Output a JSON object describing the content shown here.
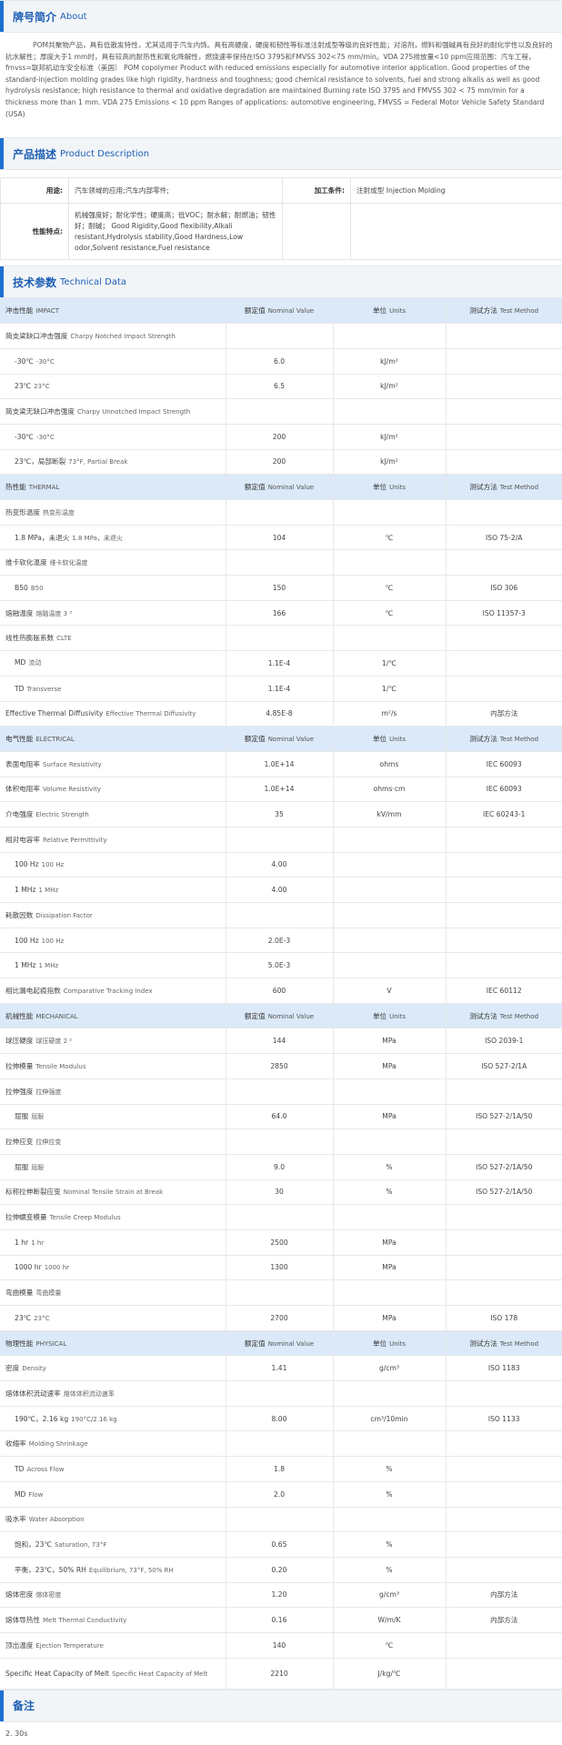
{
  "about": {
    "title_cn": "牌号简介",
    "title_en": "About",
    "text": "POM共聚物产品，具有低散发特性，尤其适用于汽车内饰。具有高硬度，硬度和韧性等标准注射成型等级的良好性能；对溶剂，燃料和强碱具有良好的耐化学性以及良好的抗水解性；厚度大于1 mm时，具有较高的耐热性和氧化降解性，燃烧速率保持在ISO 3795和FMVSS 302<75 mm/min。VDA 275排放量<10 ppm应用范围：汽车工程，fmvss=联邦机动车安全标准（美国） POM copolymer Product with reduced emissions especially for automotive interior application. Good properties of the standard-injection molding grades like high rigidity, hardness and toughness; good chemical resistance to solvents, fuel and strong alkalis as well as good hydrolysis resistance; high resistance to thermal and oxidative degradation are maintained Burning rate ISO 3795 and FMVSS 302 < 75 mm/min for a thickness more than 1 mm. VDA 275 Emissions < 10 ppm Ranges of applications: automotive engineering, FMVSS = Federal Motor Vehicle Safety Standard (USA)"
  },
  "product": {
    "title_cn": "产品描述",
    "title_en": "Product Description",
    "use_label": "用途:",
    "use_value": "汽车领域的应用;汽车内部零件;",
    "process_label": "加工条件:",
    "process_value": "注射成型 Injection Molding",
    "feature_label": "性能特点:",
    "feature_value": "机械强度好；耐化学性；硬度高；低VOC；耐水解；耐燃油；韧性好；耐碱； Good Rigidity,Good flexibility,Alkali resistant,Hydrolysis stability,Good Hardness,Low odor,Solvent resistance,Fuel resistance"
  },
  "tech": {
    "title_cn": "技术参数",
    "title_en": "Technical Data",
    "hdr_nominal_cn": "额定值",
    "hdr_nominal_en": "Nominal Value",
    "hdr_units_cn": "单位",
    "hdr_units_en": "Units",
    "hdr_method_cn": "测试方法",
    "hdr_method_en": "Test Method",
    "rows": [
      {
        "type": "cat",
        "cn": "冲击性能",
        "en": "IMPACT"
      },
      {
        "cn": "简支梁缺口冲击强度",
        "en": "Charpy Notched Impact Strength",
        "v": "",
        "u": "",
        "m": ""
      },
      {
        "sub": true,
        "cn": "-30℃",
        "en": "-30°C",
        "v": "6.0",
        "u": "kJ/m²",
        "m": ""
      },
      {
        "sub": true,
        "cn": "23℃",
        "en": "23°C",
        "v": "6.5",
        "u": "kJ/m²",
        "m": ""
      },
      {
        "cn": "简支梁无缺口冲击强度",
        "en": "Charpy Unnotched Impact Strength",
        "v": "",
        "u": "",
        "m": ""
      },
      {
        "sub": true,
        "cn": "-30℃",
        "en": "-30°C",
        "v": "200",
        "u": "kJ/m²",
        "m": ""
      },
      {
        "sub": true,
        "cn": "23℃，局部断裂",
        "en": "73°F, Partial Break",
        "v": "200",
        "u": "kJ/m²",
        "m": ""
      },
      {
        "type": "cat",
        "cn": "热性能",
        "en": "THERMAL"
      },
      {
        "cn": "热变形温度",
        "en": "热变形温度",
        "v": "",
        "u": "",
        "m": ""
      },
      {
        "sub": true,
        "cn": "1.8 MPa，未退火",
        "en": "1.8 MPa，未退火",
        "v": "104",
        "u": "℃",
        "m": "ISO 75-2/A"
      },
      {
        "cn": "维卡软化温度",
        "en": "维卡软化温度",
        "v": "",
        "u": "",
        "m": ""
      },
      {
        "sub": true,
        "cn": "B50",
        "en": "B50",
        "v": "150",
        "u": "℃",
        "m": "ISO 306"
      },
      {
        "cn": "熔融温度",
        "en": "熔融温度 3 ³",
        "v": "166",
        "u": "℃",
        "m": "ISO 11357-3",
        "link": true
      },
      {
        "cn": "线性热膨胀系数",
        "en": "CLTE",
        "v": "",
        "u": "",
        "m": ""
      },
      {
        "sub": true,
        "cn": "MD",
        "en": "流动",
        "v": "1.1E-4",
        "u": "1/℃",
        "m": ""
      },
      {
        "sub": true,
        "cn": "TD",
        "en": "Transverse",
        "v": "1.1E-4",
        "u": "1/℃",
        "m": ""
      },
      {
        "cn": "Effective Thermal Diffusivity",
        "en": "Effective Thermal Diffusivity",
        "v": "4.85E-8",
        "u": "m²/s",
        "m": "内部方法"
      },
      {
        "type": "cat",
        "cn": "电气性能",
        "en": "ELECTRICAL"
      },
      {
        "cn": "表面电阻率",
        "en": "Surface Resistivity",
        "v": "1.0E+14",
        "u": "ohms",
        "m": "IEC 60093"
      },
      {
        "cn": "体积电阻率",
        "en": "Volume Resistivity",
        "v": "1.0E+14",
        "u": "ohms·cm",
        "m": "IEC 60093"
      },
      {
        "cn": "介电强度",
        "en": "Electric Strength",
        "v": "35",
        "u": "kV/mm",
        "m": "IEC 60243-1"
      },
      {
        "cn": "相对电容率",
        "en": "Relative Permittivity",
        "v": "",
        "u": "",
        "m": ""
      },
      {
        "sub": true,
        "cn": "100 Hz",
        "en": "100 Hz",
        "v": "4.00",
        "u": "",
        "m": ""
      },
      {
        "sub": true,
        "cn": "1 MHz",
        "en": "1 MHz",
        "v": "4.00",
        "u": "",
        "m": ""
      },
      {
        "cn": "耗散因数",
        "en": "Dissipation Factor",
        "v": "",
        "u": "",
        "m": ""
      },
      {
        "sub": true,
        "cn": "100 Hz",
        "en": "100 Hz",
        "v": "2.0E-3",
        "u": "",
        "m": ""
      },
      {
        "sub": true,
        "cn": "1 MHz",
        "en": "1 MHz",
        "v": "5.0E-3",
        "u": "",
        "m": ""
      },
      {
        "cn": "相比漏电起痕指数",
        "en": "Comparative Tracking Index",
        "v": "600",
        "u": "V",
        "m": "IEC 60112"
      },
      {
        "type": "cat",
        "cn": "机械性能",
        "en": "MECHANICAL"
      },
      {
        "cn": "球压硬度",
        "en": "球压硬度 2 ²",
        "v": "144",
        "u": "MPa",
        "m": "ISO 2039-1"
      },
      {
        "cn": "拉伸模量",
        "en": "Tensile Modulus",
        "v": "2850",
        "u": "MPa",
        "m": "ISO 527-2/1A"
      },
      {
        "cn": "拉伸强度",
        "en": "拉伸强度",
        "v": "",
        "u": "",
        "m": ""
      },
      {
        "sub": true,
        "cn": "屈服",
        "en": "屈服",
        "v": "64.0",
        "u": "MPa",
        "m": "ISO 527-2/1A/50"
      },
      {
        "cn": "拉伸应变",
        "en": "拉伸应变",
        "v": "",
        "u": "",
        "m": ""
      },
      {
        "sub": true,
        "cn": "屈服",
        "en": "屈服",
        "v": "9.0",
        "u": "%",
        "m": "ISO 527-2/1A/50"
      },
      {
        "cn": "标称拉伸断裂应变",
        "en": "Nominal Tensile Strain at Break",
        "v": "30",
        "u": "%",
        "m": "ISO 527-2/1A/50"
      },
      {
        "cn": "拉伸蠕变模量",
        "en": "Tensile Creep Modulus",
        "v": "",
        "u": "",
        "m": ""
      },
      {
        "sub": true,
        "cn": "1 hr",
        "en": "1 hr",
        "v": "2500",
        "u": "MPa",
        "m": ""
      },
      {
        "sub": true,
        "cn": "1000 hr",
        "en": "1000 hr",
        "v": "1300",
        "u": "MPa",
        "m": ""
      },
      {
        "cn": "弯曲模量",
        "en": "弯曲模量",
        "v": "",
        "u": "",
        "m": ""
      },
      {
        "sub": true,
        "cn": "23℃",
        "en": "23°C",
        "v": "2700",
        "u": "MPa",
        "m": "ISO 178"
      },
      {
        "type": "cat",
        "cn": "物理性能",
        "en": "PHYSICAL"
      },
      {
        "cn": "密度",
        "en": "Density",
        "v": "1.41",
        "u": "g/cm³",
        "m": "ISO 1183"
      },
      {
        "cn": "熔体体积流动速率",
        "en": "熔体体积流动速率",
        "v": "",
        "u": "",
        "m": ""
      },
      {
        "sub": true,
        "cn": "190℃，2.16 kg",
        "en": "190°C/2.16 kg",
        "v": "8.00",
        "u": "cm³/10min",
        "m": "ISO 1133",
        "link": true
      },
      {
        "cn": "收缩率",
        "en": "Molding Shrinkage",
        "v": "",
        "u": "",
        "m": ""
      },
      {
        "sub": true,
        "cn": "TD",
        "en": "Across Flow",
        "v": "1.8",
        "u": "%",
        "m": ""
      },
      {
        "sub": true,
        "cn": "MD",
        "en": "Flow",
        "v": "2.0",
        "u": "%",
        "m": ""
      },
      {
        "cn": "吸水率",
        "en": "Water Absorption",
        "v": "",
        "u": "",
        "m": ""
      },
      {
        "sub": true,
        "cn": "饱和，23℃",
        "en": "Saturation, 73°F",
        "v": "0.65",
        "u": "%",
        "m": ""
      },
      {
        "sub": true,
        "cn": "平衡，23℃，50% RH",
        "en": "Equilibrium, 73°F, 50% RH",
        "v": "0.20",
        "u": "%",
        "m": ""
      },
      {
        "cn": "熔体密度",
        "en": "熔体密度",
        "v": "1.20",
        "u": "g/cm³",
        "m": "内部方法"
      },
      {
        "cn": "熔体导热性",
        "en": "Melt Thermal Conductivity",
        "v": "0.16",
        "u": "W/m/K",
        "m": "内部方法"
      },
      {
        "cn": "顶出温度",
        "en": "Ejection Temperature",
        "v": "140",
        "u": "℃",
        "m": ""
      },
      {
        "cn": "Specific Heat Capacity of Melt",
        "en": "Specific Heat Capacity of Melt",
        "v": "2210",
        "u": "J/kg/℃",
        "m": "",
        "tall": true
      }
    ]
  },
  "notes": {
    "title_cn": "备注",
    "text": "2. 30s"
  }
}
